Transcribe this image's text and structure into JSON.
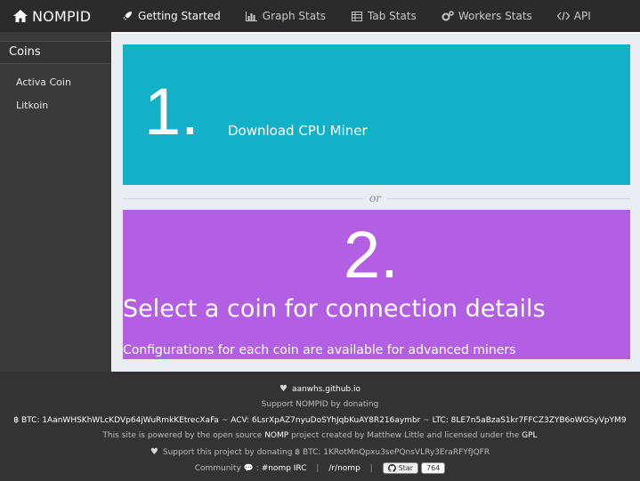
{
  "brand": {
    "name": "NOMPID",
    "icon": "home-icon"
  },
  "nav": [
    {
      "label": "Getting Started",
      "icon": "rocket-icon",
      "active": true
    },
    {
      "label": "Graph Stats",
      "icon": "bar-chart-icon"
    },
    {
      "label": "Tab Stats",
      "icon": "table-icon"
    },
    {
      "label": "Workers Stats",
      "icon": "gears-icon"
    },
    {
      "label": "API",
      "icon": "code-icon"
    }
  ],
  "sidebar": {
    "heading": "Coins",
    "coins": [
      "Activa Coin",
      "Litkoin"
    ]
  },
  "main": {
    "step1": {
      "number": "1.",
      "link": "Download CPU Miner",
      "color": "#12b1c9"
    },
    "divider": "or",
    "step2": {
      "number": "2.",
      "title": "Select a coin for connection details",
      "note": "Configurations for each coin are available for advanced miners",
      "color": "#b35fe3"
    }
  },
  "footer": {
    "site": "aanwhs.github.io",
    "support": "Support NOMPID by donating",
    "btc_label": "฿ BTC: 1AanWHSKhWLcKDVp64jWuRmkKEtrecXaFa",
    "acv_label": "ACV: 6LsrXpAZ7nyuDoSYhJqbKuAY8R216aymbr",
    "ltc_label": "LTC: 8LE7n5aBzaS1kr7FFCZ3ZYB6oWGSyVpYM9",
    "tilde": "~",
    "powered_pre": "This site is powered by the open source",
    "nomp": "NOMP",
    "powered_mid": "project created by Matthew Little and licensed under the",
    "gpl": "GPL",
    "support_project": "Support this project by donating",
    "support_btc": "฿ BTC: 1KRotMnQpxu3sePQnsVLRy3EraRFYfJQFR",
    "community": "Community",
    "colon": ":",
    "irc": "#nomp IRC",
    "reddit": "/r/nomp",
    "pipe": "|",
    "star": "Star",
    "star_count": "764"
  }
}
